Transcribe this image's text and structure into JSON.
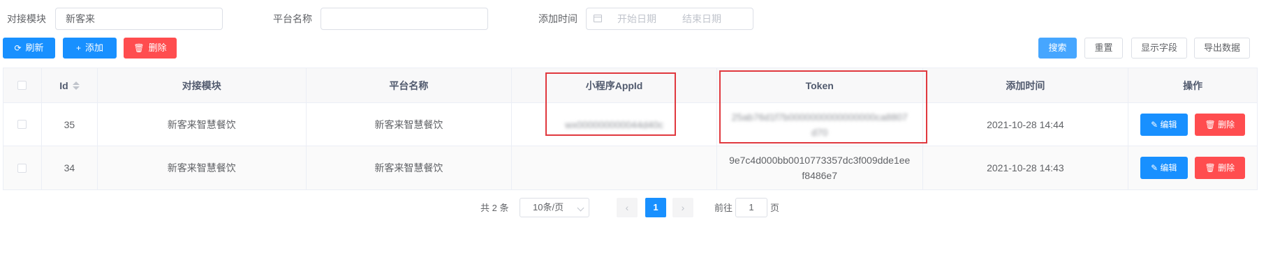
{
  "filters": {
    "module_label": "对接模块",
    "module_value": "新客来",
    "platform_label": "平台名称",
    "platform_value": "",
    "time_label": "添加时间",
    "start_placeholder": "开始日期",
    "end_placeholder": "结束日期"
  },
  "toolbar": {
    "refresh": "刷新",
    "add": "添加",
    "delete": "删除",
    "search": "搜索",
    "reset": "重置",
    "show_fields": "显示字段",
    "export": "导出数据"
  },
  "table": {
    "headers": [
      "Id",
      "对接模块",
      "平台名称",
      "小程序AppId",
      "Token",
      "添加时间",
      "操作"
    ],
    "rows": [
      {
        "id": "35",
        "module": "新客来智慧餐饮",
        "platform": "新客来智慧餐饮",
        "appid": "wx000000000044d40c",
        "token": "25ab76d1f7b0000000000000000ca8807d70",
        "time": "2021-10-28 14:44"
      },
      {
        "id": "34",
        "module": "新客来智慧餐饮",
        "platform": "新客来智慧餐饮",
        "appid": "",
        "token": "9e7c4d000bb0010773357dc3f009dde1eef8486e7",
        "time": "2021-10-28 14:43"
      }
    ],
    "edit_label": "编辑",
    "delete_label": "删除"
  },
  "pagination": {
    "total_text": "共 2 条",
    "page_size": "10条/页",
    "current_page": "1",
    "goto_label": "前往",
    "goto_value": "1",
    "page_unit": "页"
  },
  "colors": {
    "primary": "#1890ff",
    "danger": "#ff4d4f",
    "highlight": "#e0383e"
  },
  "icons": {
    "refresh": "refresh-icon",
    "add": "plus-icon",
    "delete": "trash-icon",
    "edit": "pencil-icon",
    "calendar": "calendar-icon",
    "sort": "sort-caret-icon"
  }
}
